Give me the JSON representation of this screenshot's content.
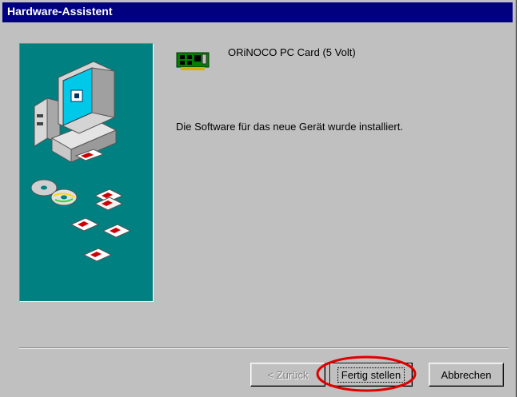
{
  "window": {
    "title": "Hardware-Assistent"
  },
  "device": {
    "icon": "network-card-icon",
    "name": "ORiNOCO PC Card (5 Volt)"
  },
  "message": "Die Software für das neue Gerät wurde installiert.",
  "buttons": {
    "back": {
      "label": "< Zurück",
      "enabled": false
    },
    "finish": {
      "label": "Fertig stellen",
      "focused": true
    },
    "cancel": {
      "label": "Abbrechen"
    }
  },
  "annotation": {
    "highlight_color": "#e00000",
    "highlight_target": "finish-button"
  },
  "colors": {
    "titlebar": "#000080",
    "side_panel": "#008080",
    "face": "#c0c0c0"
  }
}
